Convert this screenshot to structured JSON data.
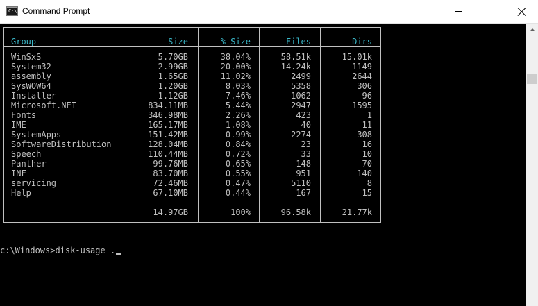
{
  "window": {
    "title": "Command Prompt",
    "icon": "cmd-icon",
    "icon_glyph": "C:\\"
  },
  "table": {
    "headers": [
      "Group",
      "Size",
      "% Size",
      "Files",
      "Dirs"
    ],
    "rows": [
      [
        "WinSxS",
        "5.70GB",
        "38.04%",
        "58.51k",
        "15.01k"
      ],
      [
        "System32",
        "2.99GB",
        "20.00%",
        "14.24k",
        "1149"
      ],
      [
        "assembly",
        "1.65GB",
        "11.02%",
        "2499",
        "2644"
      ],
      [
        "SysWOW64",
        "1.20GB",
        "8.03%",
        "5358",
        "306"
      ],
      [
        "Installer",
        "1.12GB",
        "7.46%",
        "1062",
        "96"
      ],
      [
        "Microsoft.NET",
        "834.11MB",
        "5.44%",
        "2947",
        "1595"
      ],
      [
        "Fonts",
        "346.98MB",
        "2.26%",
        "423",
        "1"
      ],
      [
        "IME",
        "165.17MB",
        "1.08%",
        "40",
        "11"
      ],
      [
        "SystemApps",
        "151.42MB",
        "0.99%",
        "2274",
        "308"
      ],
      [
        "SoftwareDistribution",
        "128.04MB",
        "0.84%",
        "23",
        "16"
      ],
      [
        "Speech",
        "110.44MB",
        "0.72%",
        "33",
        "10"
      ],
      [
        "Panther",
        "99.76MB",
        "0.65%",
        "148",
        "70"
      ],
      [
        "INF",
        "83.70MB",
        "0.55%",
        "951",
        "140"
      ],
      [
        "servicing",
        "72.46MB",
        "0.47%",
        "5110",
        "8"
      ],
      [
        "Help",
        "67.10MB",
        "0.44%",
        "167",
        "15"
      ]
    ],
    "totals": [
      "14.97GB",
      "100%",
      "96.58k",
      "21.77k"
    ]
  },
  "prompt": {
    "text": "c:\\Windows>disk-usage ."
  },
  "colors": {
    "background": "#000000",
    "text": "#c0c0c0",
    "header": "#3ab7c8"
  }
}
